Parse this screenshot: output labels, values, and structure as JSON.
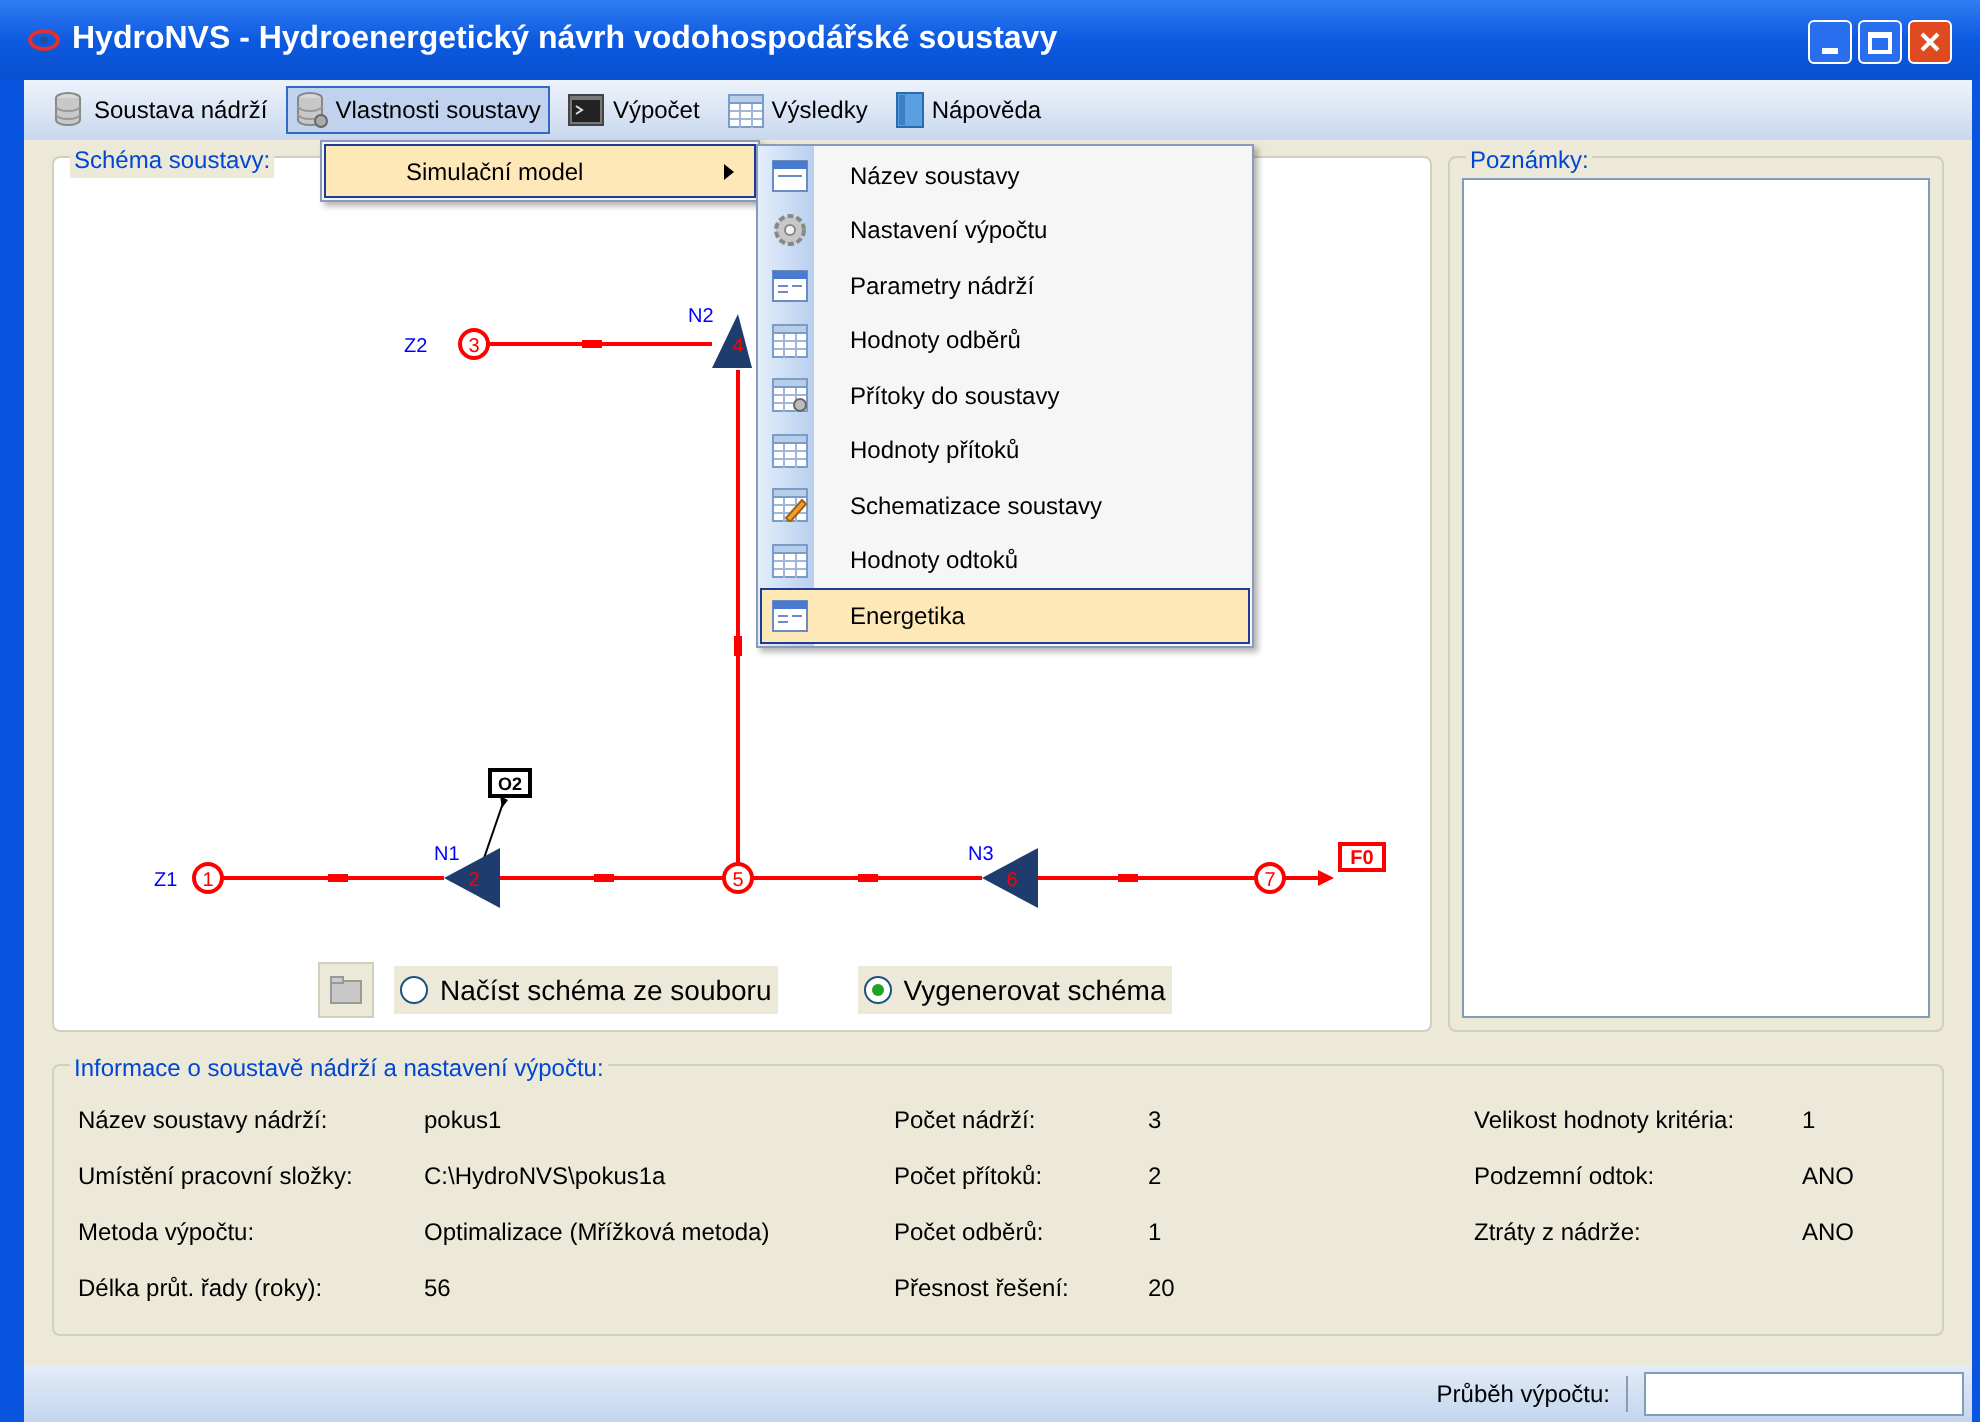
{
  "window": {
    "title": "HydroNVS - Hydroenergetický návrh vodohospodářské soustavy"
  },
  "menu": [
    {
      "label": "Soustava nádrží",
      "selected": false
    },
    {
      "label": "Vlastnosti soustavy",
      "selected": true
    },
    {
      "label": "Výpočet",
      "selected": false
    },
    {
      "label": "Výsledky",
      "selected": false
    },
    {
      "label": "Nápověda",
      "selected": false
    }
  ],
  "dropdown": {
    "items": [
      {
        "label": "Simulační model",
        "selected": true
      }
    ]
  },
  "submenu": {
    "items": [
      {
        "label": "Název soustavy",
        "selected": false
      },
      {
        "label": "Nastavení výpočtu",
        "selected": false
      },
      {
        "label": "Parametry nádrží",
        "selected": false
      },
      {
        "label": "Hodnoty odběrů",
        "selected": false
      },
      {
        "label": "Přítoky do soustavy",
        "selected": false
      },
      {
        "label": "Hodnoty přítoků",
        "selected": false
      },
      {
        "label": "Schematizace soustavy",
        "selected": false
      },
      {
        "label": "Hodnoty odtoků",
        "selected": false
      },
      {
        "label": "Energetika",
        "selected": true
      }
    ]
  },
  "schema_panel": {
    "title": "Schéma soustavy:",
    "diagram": {
      "nodes": [
        {
          "kind": "source",
          "name": "Z1",
          "number": "1"
        },
        {
          "kind": "reservoir",
          "name": "N1",
          "number": "2"
        },
        {
          "kind": "withdrawal",
          "name": "O2"
        },
        {
          "kind": "junction",
          "number": "5"
        },
        {
          "kind": "reservoir",
          "name": "N3",
          "number": "6"
        },
        {
          "kind": "junction",
          "number": "7"
        },
        {
          "kind": "outlet",
          "name": "F0"
        },
        {
          "kind": "source",
          "name": "Z2",
          "number": "3"
        },
        {
          "kind": "reservoir",
          "name": "N2",
          "number": "4"
        }
      ]
    },
    "options": [
      {
        "label": "Načíst schéma ze souboru",
        "selected": false
      },
      {
        "label": "Vygenerovat schéma",
        "selected": true
      }
    ]
  },
  "notes_panel": {
    "title": "Poznámky:"
  },
  "info_group": {
    "title": "Informace o soustavě nádrží a nastavení výpočtu:",
    "columns": [
      [
        {
          "label": "Název soustavy nádrží:",
          "value": "pokus1"
        },
        {
          "label": "Umístění pracovní složky:",
          "value": "C:\\HydroNVS\\pokus1a"
        },
        {
          "label": "Metoda výpočtu:",
          "value": "Optimalizace (Mřížková metoda)"
        },
        {
          "label": "Délka průt. řady (roky):",
          "value": "56"
        }
      ],
      [
        {
          "label": "Počet nádrží:",
          "value": "3"
        },
        {
          "label": "Počet přítoků:",
          "value": "2"
        },
        {
          "label": "Počet odběrů:",
          "value": "1"
        },
        {
          "label": "Přesnost řešení:",
          "value": "20"
        }
      ],
      [
        {
          "label": "Velikost hodnoty kritéria:",
          "value": "1"
        },
        {
          "label": "Podzemní odtok:",
          "value": "ANO"
        },
        {
          "label": "Ztráty z nádrže:",
          "value": "ANO"
        }
      ]
    ]
  },
  "status_bar": {
    "label": "Průběh výpočtu:"
  }
}
